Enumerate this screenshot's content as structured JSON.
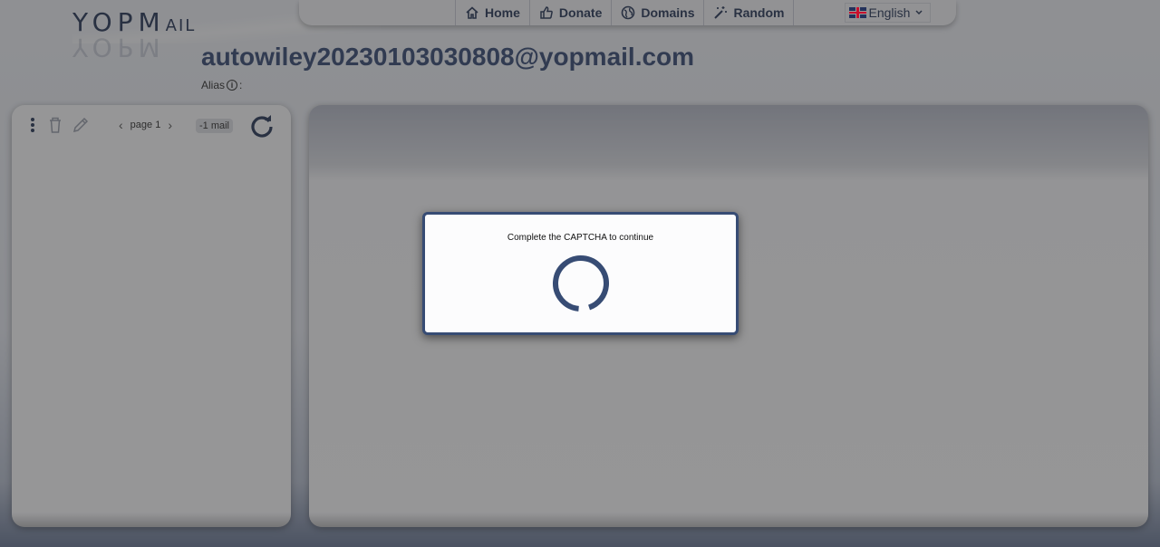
{
  "brand": {
    "logo_main": "YOPM",
    "logo_tail": "AIL"
  },
  "nav": {
    "home": "Home",
    "donate": "Donate",
    "domains": "Domains",
    "random": "Random",
    "language": "English"
  },
  "inbox": {
    "email": "autowiley20230103030808@yopmail.com",
    "alias_label": "Alias",
    "alias_suffix": ":",
    "page_label": "page 1",
    "mail_count": "-1 mail"
  },
  "modal": {
    "message": "Complete the CAPTCHA to continue"
  },
  "colors": {
    "accent": "#2b3a5b",
    "modal_border": "#374c74",
    "overlay": "rgba(40,40,40,0.48)"
  },
  "icons": [
    "home-icon",
    "thumbs-up-icon",
    "globe-icon",
    "magic-wand-icon",
    "uk-flag-icon",
    "chevron-down-icon",
    "info-icon",
    "kebab-menu-icon",
    "trash-icon",
    "pencil-icon",
    "chevron-left-icon",
    "chevron-right-icon",
    "refresh-icon",
    "spinner-icon"
  ]
}
